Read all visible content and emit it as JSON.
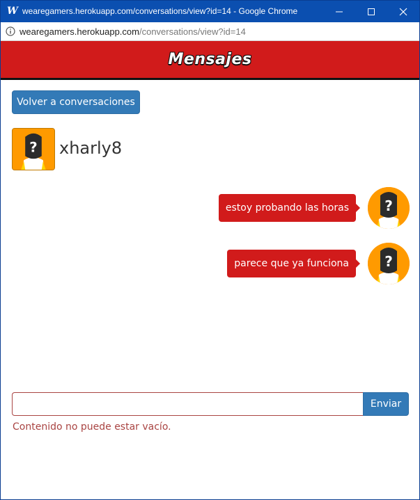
{
  "window": {
    "title": "wearegamers.herokuapp.com/conversations/view?id=14 - Google Chrome",
    "app_icon": "W",
    "controls": [
      "minimize-icon",
      "maximize-icon",
      "close-icon"
    ]
  },
  "address_bar": {
    "host": "wearegamers.herokuapp.com",
    "path": "/conversations/view?id=14",
    "icon": "info-icon"
  },
  "header": {
    "title": "Mensajes"
  },
  "back_button": {
    "label": "Volver a conversaciones"
  },
  "contact": {
    "name": "xharly8",
    "avatar_icon": "unknown-user-avatar"
  },
  "messages": [
    {
      "text": "estoy probando las horas",
      "side": "right"
    },
    {
      "text": "parece que ya funciona",
      "side": "right"
    }
  ],
  "composer": {
    "value": "",
    "placeholder": "",
    "send_label": "Enviar",
    "error": "Contenido no puede estar vacío."
  },
  "colors": {
    "titlebar": "#0b4fb0",
    "header": "#d11b1b",
    "primary_button": "#337ab7",
    "bubble": "#d11b1b",
    "error": "#a94442",
    "avatar_bg": "#ff9a00"
  }
}
